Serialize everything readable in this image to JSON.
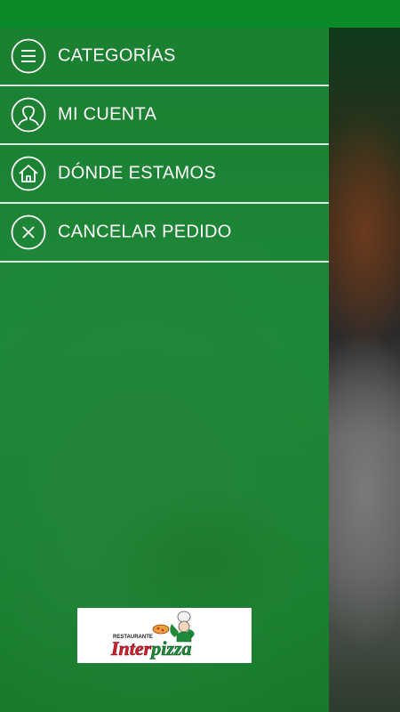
{
  "colors": {
    "status_bar": "#0b8a2a",
    "drawer_green": "#1e8838",
    "divider": "#ffffff",
    "logo_red": "#d2202e",
    "logo_green": "#1f8a3a"
  },
  "drawer": {
    "items": [
      {
        "label": "CATEGORÍAS",
        "icon": "menu-icon"
      },
      {
        "label": "MI CUENTA",
        "icon": "user-icon"
      },
      {
        "label": "DÓNDE ESTAMOS",
        "icon": "home-icon"
      },
      {
        "label": "CANCELAR PEDIDO",
        "icon": "close-icon"
      }
    ]
  },
  "logo": {
    "small_text": "RESTAURANTE",
    "brand_red": "Inter",
    "brand_green": "pizza"
  }
}
